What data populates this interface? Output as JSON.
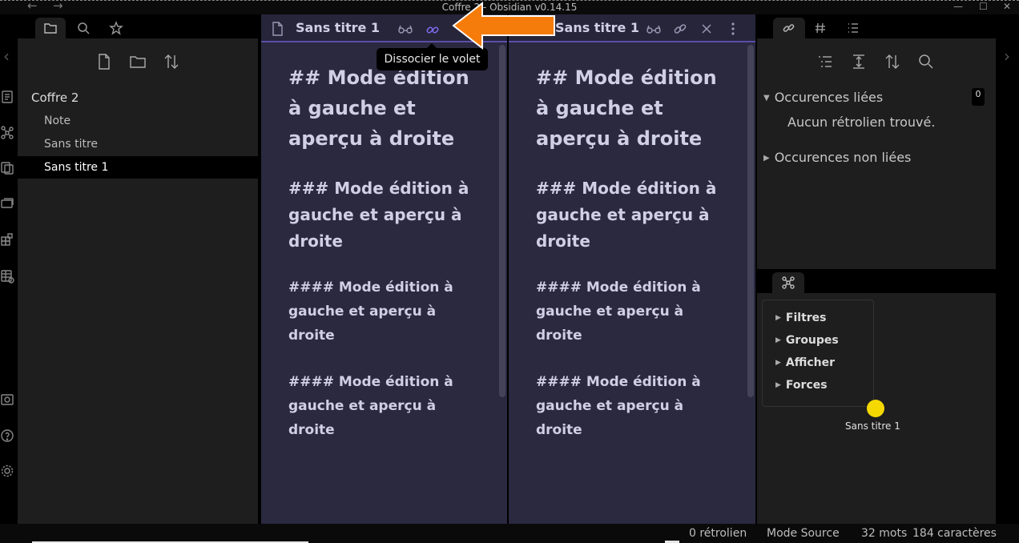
{
  "window": {
    "title": "Coffre 2 - Obsidian v0.14.15",
    "back_arrow": "←",
    "forward_arrow": "→",
    "minimize": "—",
    "maximize": "☐",
    "close": "✕"
  },
  "ribbon": {
    "icons": [
      "switcher-icon",
      "graph-icon",
      "copy-icon",
      "slides-icon",
      "templates-icon",
      "table-icon",
      "vault-icon",
      "help-icon",
      "settings-icon"
    ]
  },
  "left_sidebar": {
    "tabs": [
      "folder-icon",
      "search-icon",
      "star-icon"
    ],
    "toolbar": [
      "new-note-icon",
      "new-folder-icon",
      "sort-icon"
    ],
    "vault_name": "Coffre 2",
    "files": [
      {
        "label": "Note",
        "active": false
      },
      {
        "label": "Sans titre",
        "active": false
      },
      {
        "label": "Sans titre 1",
        "active": true
      }
    ]
  },
  "editor_left": {
    "title": "Sans titre 1",
    "content": {
      "h2": "## Mode édition à gauche et aperçu à droite",
      "h3": "### Mode édition à gauche et aperçu à droite",
      "h4a": "#### Mode édition à gauche et aperçu à droite",
      "h4b": "#### Mode édition à gauche et aperçu à droite"
    }
  },
  "editor_right": {
    "title": "Sans titre 1",
    "content": {
      "h2": "## Mode édition à gauche et aperçu à droite",
      "h3": "### Mode édition à gauche et aperçu à droite",
      "h4a": "#### Mode édition à gauche et aperçu à droite",
      "h4b": "#### Mode édition à gauche et aperçu à droite"
    }
  },
  "tooltip": "Dissocier le volet",
  "right_sidebar": {
    "tabs": [
      "backlinks-icon",
      "tag-icon",
      "outline-icon"
    ],
    "linked_label": "Occurences liées",
    "linked_count": "0",
    "no_backlinks": "Aucun rétrolien trouvé.",
    "unlinked_label": "Occurences non liées"
  },
  "graph": {
    "tab": "graph-icon",
    "settings": [
      "Filtres",
      "Groupes",
      "Afficher",
      "Forces"
    ],
    "node_label": "Sans titre 1",
    "node_color": "#f5d800"
  },
  "status": {
    "backlinks": "0 rétrolien",
    "mode": "Mode Source",
    "words": "32 mots",
    "chars": "184 caractères"
  },
  "colors": {
    "accent": "#5b4ea8",
    "arrow": "#f57c0a",
    "pane_bg": "#2b2940"
  }
}
